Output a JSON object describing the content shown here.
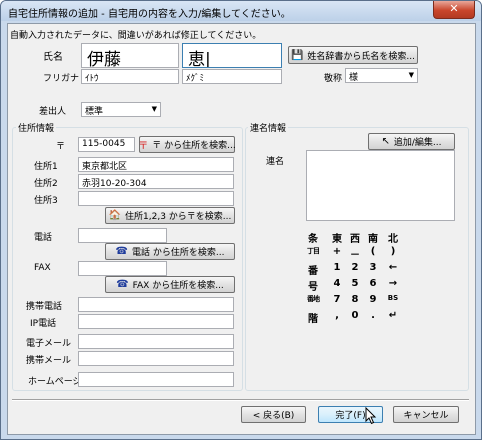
{
  "title": "自宅住所情報の追加  -  自宅用の内容を入力/編集してください。",
  "close_glyph": "✕",
  "instruction": "自動入力されたデータに、間違いがあれば修正してください。",
  "name": {
    "label": "氏名",
    "last": "伊藤",
    "first": "恵",
    "dict_button": "姓名辞書から氏名を検索..."
  },
  "furigana": {
    "label": "フリガナ",
    "last": "ｲﾄｳ",
    "first": "ﾒｸﾞﾐ"
  },
  "honorific": {
    "label": "敬称",
    "value": "様"
  },
  "sender": {
    "label": "差出人",
    "value": "標準"
  },
  "address": {
    "group_title": "住所情報",
    "postal_label": "〒",
    "postal_value": "115-0045",
    "postal_button": "〒 から住所を検索...",
    "addr1_label": "住所1",
    "addr1_value": "東京都北区",
    "addr2_label": "住所2",
    "addr2_value": "赤羽10-20-304",
    "addr3_label": "住所3",
    "addr3_value": "",
    "addr_button": "住所1,2,3 から〒を検索...",
    "phone_label": "電話",
    "phone_value": "",
    "phone_button": "電話 から住所を検索...",
    "fax_label": "FAX",
    "fax_value": "",
    "fax_button": "FAX から住所を検索...",
    "mobile_label": "携帯電話",
    "ip_label": "IP電話",
    "email_label": "電子メール",
    "mobile_email_label": "携帯メール",
    "homepage_label": "ホームページ"
  },
  "joint": {
    "group_title": "連名情報",
    "add_button": "追加/編集...",
    "list_label": "連名"
  },
  "keypad": {
    "rows": [
      [
        "条",
        "東",
        "西",
        "南",
        "北"
      ],
      [
        "丁目",
        "+",
        "－",
        "(",
        ")"
      ],
      [
        "番",
        "1",
        "2",
        "3",
        "←"
      ],
      [
        "号",
        "4",
        "5",
        "6",
        "→"
      ],
      [
        "番地",
        "7",
        "8",
        "9",
        "BS"
      ],
      [
        "階",
        ",",
        "0",
        ".",
        "↵"
      ]
    ]
  },
  "footer": {
    "back": "< 戻る(B)",
    "finish": "完了(F)",
    "cancel": "キャンセル"
  }
}
